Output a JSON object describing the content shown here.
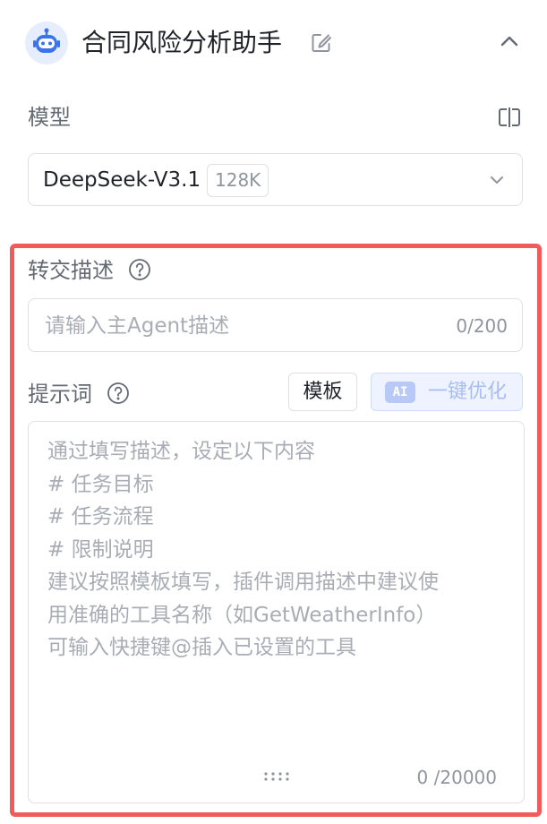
{
  "header": {
    "title": "合同风险分析助手"
  },
  "model": {
    "label": "模型",
    "selected_name": "DeepSeek-V3.1",
    "selected_badge": "128K"
  },
  "handover": {
    "label": "转交描述",
    "placeholder": "请输入主Agent描述",
    "count": "0/200"
  },
  "prompt": {
    "label": "提示词",
    "template_button": "模板",
    "optimize_icon_text": "AI",
    "optimize_button": "一键优化",
    "placeholder_lines": [
      "通过填写描述，设定以下内容",
      "# 任务目标",
      "# 任务流程",
      "# 限制说明",
      "建议按照模板填写，插件调用描述中建议使",
      "用准确的工具名称（如GetWeatherInfo）",
      "可输入快捷键@插入已设置的工具"
    ],
    "count": "0 /20000"
  },
  "colors": {
    "highlight_border": "#f15b5b",
    "optimize_accent": "#a9bdf2",
    "avatar_blue": "#3a72f0"
  }
}
